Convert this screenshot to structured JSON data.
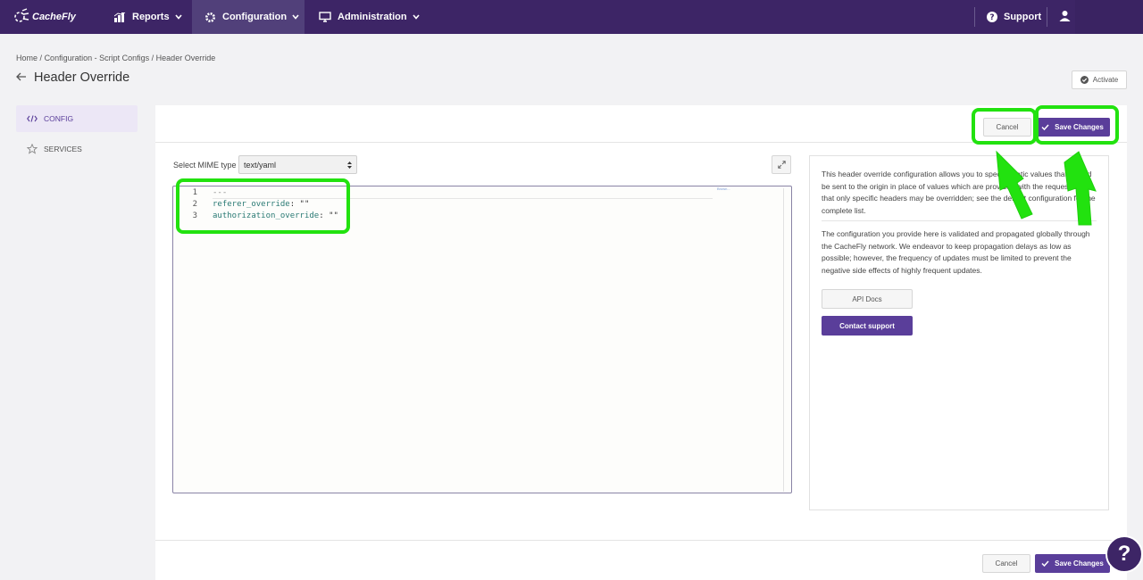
{
  "nav": {
    "logo_text": "CacheFly",
    "items": [
      {
        "label": "Reports",
        "icon": "bar-chart-icon"
      },
      {
        "label": "Configuration",
        "icon": "gear-icon"
      },
      {
        "label": "Administration",
        "icon": "monitor-icon"
      }
    ],
    "support_label": "Support",
    "accent": "#3d2566"
  },
  "breadcrumb": {
    "items": [
      "Home",
      "Configuration - Script Configs",
      "Header Override"
    ],
    "separator": "/"
  },
  "page": {
    "title": "Header Override",
    "activate_label": "Activate"
  },
  "sidebar": {
    "items": [
      {
        "label": "CONFIG",
        "icon": "code-icon",
        "active": true
      },
      {
        "label": "SERVICES",
        "icon": "star-icon",
        "active": false
      }
    ]
  },
  "actions": {
    "cancel_label": "Cancel",
    "save_label": "Save Changes"
  },
  "editor": {
    "mime_label": "Select MIME type",
    "mime_value": "text/yaml",
    "minimap_text": "Brown...",
    "lines": [
      {
        "num": "1",
        "text": "---"
      },
      {
        "num": "2",
        "key": "referer_override",
        "value": "\"\""
      },
      {
        "num": "3",
        "key": "authorization_override",
        "value": "\"\""
      }
    ]
  },
  "info": {
    "paragraph1": "This header override configuration allows you to specify static values that should be sent to the origin in place of values which are provided with the request. Note that only specific headers may be overridden; see the default configuration for the complete list.",
    "paragraph2": "The configuration you provide here is validated and propagated globally through the CacheFly network. We endeavor to keep propagation delays as low as possible; however, the frequency of updates must be limited to prevent the negative side effects of highly frequent updates.",
    "docs_label": "API Docs",
    "contact_label": "Contact support"
  },
  "help_label": "?",
  "colors": {
    "brand_purple": "#5a3e9a",
    "annotation_green": "#22e20f"
  }
}
